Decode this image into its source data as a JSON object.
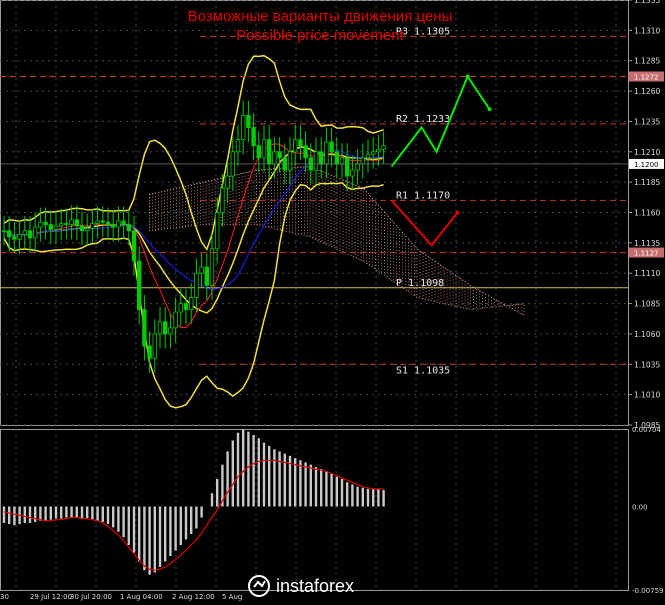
{
  "title_ru": "Возможные варианты движения цены",
  "title_en": "Possible price movement",
  "brand": "instaforex",
  "colors": {
    "background": "#000000",
    "grid": "#3a4a5a",
    "candle": "#00cc00",
    "bollinger": "#f0e040",
    "ichimoku_red": "#ff2020",
    "ichimoku_blue": "#2020ff",
    "cloud": "#d09080",
    "forecast_up": "#00ee00",
    "forecast_down": "#e00000",
    "level_line": "#c8382a",
    "pivot_line": "#d8c040",
    "histogram": "#c8c8c8",
    "signal": "#e00000",
    "title": "#e00000"
  },
  "chart_data": [
    {
      "type": "candlestick",
      "symbol": "EURUSD",
      "ylim": [
        1.0985,
        1.1335
      ],
      "price_ticks": [
        "1.1335",
        "1.1310",
        "1.1285",
        "1.1260",
        "1.1235",
        "1.1210",
        "1.1185",
        "1.1160",
        "1.1135",
        "1.1110",
        "1.1085",
        "1.1060",
        "1.1035",
        "1.1010",
        "1.0985"
      ],
      "current_price": "1.1200",
      "price_tags": [
        "1.1272",
        "1.1127"
      ],
      "levels": [
        {
          "label": "R3",
          "value": "1.1305"
        },
        {
          "label": "R2",
          "value": "1.1233"
        },
        {
          "label": "R1",
          "value": "1.1170"
        },
        {
          "label": "P",
          "value": "1.1098"
        },
        {
          "label": "S1",
          "value": "1.1035"
        }
      ],
      "time_labels": [
        "30",
        "29 Jul 12:00",
        "30 Jul 20:00",
        "1 Aug 04:00",
        "2 Aug 12:00",
        "5 Aug"
      ],
      "closes": [
        1.1145,
        1.114,
        1.1138,
        1.1142,
        1.1145,
        1.1139,
        1.1148,
        1.1152,
        1.115,
        1.1146,
        1.1149,
        1.1151,
        1.115,
        1.1154,
        1.1149,
        1.1145,
        1.1147,
        1.1151,
        1.1153,
        1.1152,
        1.115,
        1.1148,
        1.1153,
        1.115,
        1.1145,
        1.112,
        1.108,
        1.105,
        1.104,
        1.106,
        1.107,
        1.106,
        1.1065,
        1.1078,
        1.1085,
        1.108,
        1.109,
        1.111,
        1.1115,
        1.11,
        1.113,
        1.116,
        1.118,
        1.119,
        1.121,
        1.122,
        1.124,
        1.123,
        1.1215,
        1.1205,
        1.122,
        1.12,
        1.121,
        1.1205,
        1.1195,
        1.121,
        1.122,
        1.1215,
        1.1205,
        1.1195,
        1.121,
        1.12,
        1.1218,
        1.121,
        1.12,
        1.1205,
        1.119,
        1.1195,
        1.12,
        1.1205,
        1.1208,
        1.121,
        1.1212,
        1.1215
      ],
      "ichimoku_cloud": {
        "top": [
          1.1175,
          1.1185,
          1.1195,
          1.1198,
          1.118,
          1.113,
          1.11,
          1.1075
        ],
        "bottom": [
          1.1145,
          1.115,
          1.115,
          1.114,
          1.112,
          1.109,
          1.108,
          1.1085
        ]
      },
      "forecast_up": [
        1.1198,
        1.123,
        1.121,
        1.1272,
        1.1245
      ],
      "forecast_down": [
        1.117,
        1.1133,
        1.116
      ]
    },
    {
      "type": "bar",
      "name": "MACD",
      "ylim": [
        -0.00759,
        0.00704
      ],
      "ticks": [
        "0.00704",
        "0.00",
        "-0.00759"
      ],
      "histogram": [
        -0.0015,
        -0.0016,
        -0.0017,
        -0.0016,
        -0.0015,
        -0.0015,
        -0.0014,
        -0.0013,
        -0.0013,
        -0.0012,
        -0.0011,
        -0.0011,
        -0.001,
        -0.001,
        -0.001,
        -0.0011,
        -0.0011,
        -0.0012,
        -0.0013,
        -0.0014,
        -0.0016,
        -0.0019,
        -0.0023,
        -0.0028,
        -0.0035,
        -0.0042,
        -0.005,
        -0.0058,
        -0.0062,
        -0.006,
        -0.0055,
        -0.005,
        -0.0045,
        -0.004,
        -0.0035,
        -0.003,
        -0.0025,
        -0.002,
        -0.001,
        0.0,
        0.0012,
        0.0025,
        0.0038,
        0.005,
        0.006,
        0.0067,
        0.007,
        0.0068,
        0.0065,
        0.0062,
        0.0058,
        0.0055,
        0.0052,
        0.005,
        0.0048,
        0.0046,
        0.0044,
        0.0042,
        0.004,
        0.0038,
        0.0036,
        0.0034,
        0.0032,
        0.003,
        0.0027,
        0.0025,
        0.0022,
        0.002,
        0.0018,
        0.0017,
        0.0016,
        0.0016,
        0.0016,
        0.0015
      ],
      "signal": [
        -0.0005,
        -0.0006,
        -0.0007,
        -0.0008,
        -0.0009,
        -0.001,
        -0.0011,
        -0.0012,
        -0.0013,
        -0.0013,
        -0.0012,
        -0.0012,
        -0.0011,
        -0.001,
        -0.001,
        -0.0011,
        -0.0011,
        -0.0012,
        -0.0013,
        -0.0015,
        -0.0018,
        -0.0022,
        -0.0026,
        -0.0031,
        -0.0037,
        -0.0043,
        -0.0049,
        -0.0054,
        -0.0057,
        -0.0058,
        -0.0057,
        -0.0055,
        -0.0052,
        -0.0048,
        -0.0044,
        -0.004,
        -0.0035,
        -0.003,
        -0.0024,
        -0.0017,
        -0.001,
        -0.0003,
        0.0005,
        0.0013,
        0.002,
        0.0027,
        0.0032,
        0.0036,
        0.0039,
        0.0041,
        0.0042,
        0.0042,
        0.0042,
        0.0041,
        0.004,
        0.0039,
        0.0038,
        0.0037,
        0.0036,
        0.0035,
        0.0034,
        0.0033,
        0.0032,
        0.003,
        0.0028,
        0.0026,
        0.0024,
        0.0022,
        0.002,
        0.0018,
        0.0017,
        0.0016,
        0.0016,
        0.0016
      ]
    }
  ]
}
